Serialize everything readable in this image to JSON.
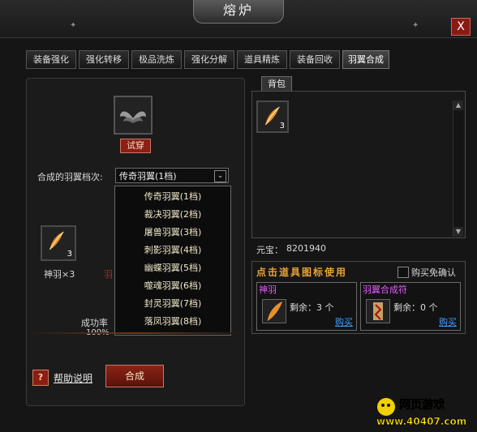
{
  "window": {
    "title": "熔炉",
    "close_glyph": "X"
  },
  "tabs": [
    {
      "label": "装备强化"
    },
    {
      "label": "强化转移"
    },
    {
      "label": "极品洗炼"
    },
    {
      "label": "强化分解"
    },
    {
      "label": "道具精炼"
    },
    {
      "label": "装备回收"
    },
    {
      "label": "羽翼合成",
      "active": true
    }
  ],
  "left": {
    "try_label": "试穿",
    "grade_label": "合成的羽翼档次:",
    "selected_grade": "传奇羽翼(1档)",
    "options": [
      "传奇羽翼(1档)",
      "裁决羽翼(2档)",
      "屠兽羽翼(3档)",
      "刺影羽翼(4档)",
      "幽蝶羽翼(5档)",
      "噬魂羽翼(6档)",
      "封灵羽翼(7档)",
      "落凤羽翼(8档)"
    ],
    "material": {
      "qty": "3",
      "label": "神羽×3",
      "hidden_red": "羽"
    },
    "success_label": "成功率",
    "success_value": "100%",
    "help_icon": "?",
    "help_label": "帮助说明",
    "combine_label": "合成"
  },
  "bag": {
    "tab_label": "背包",
    "items": [
      {
        "qty": "3"
      }
    ],
    "scroll_up": "▲",
    "scroll_down": "▼"
  },
  "currency": {
    "label": "元宝：",
    "value": "8201940"
  },
  "shop": {
    "header": "点击道具图标使用",
    "auto_buy_label": "购买免确认",
    "items": [
      {
        "title": "神羽",
        "remain": "剩余：3 个",
        "buy": "购买"
      },
      {
        "title": "羽翼合成符",
        "remain": "剩余：0 个",
        "buy": "购买"
      }
    ]
  },
  "logo": {
    "top": "网页游戏",
    "bottom": "www.40407.com"
  },
  "colors": {
    "accent_red": "#8b1e16",
    "gold_text": "#e6a238",
    "purple_title": "#e45cff",
    "link_blue": "#3fa0ff"
  }
}
